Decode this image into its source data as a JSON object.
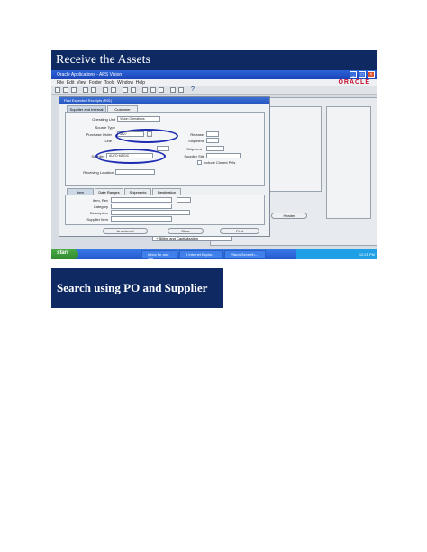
{
  "slide": {
    "title": "Receive the Assets",
    "caption": "Search using PO and Supplier"
  },
  "app": {
    "window_title": "Oracle Applications - ARS Vision",
    "menu": [
      "File",
      "Edit",
      "View",
      "Folder",
      "Tools",
      "Window",
      "Help"
    ],
    "brand": "ORACLE",
    "help_icon": "?"
  },
  "find_form": {
    "title": "Find Expected Receipts (R01)",
    "tabs": [
      "Supplier and Internal",
      "Customer"
    ],
    "fields": {
      "operating_unit_label": "Operating Unit",
      "operating_unit_value": "Vision Operations",
      "source_type_label": "Source Type",
      "purchase_order_label": "Purchase Order",
      "purchase_order_value": "5827",
      "line_label": "Line",
      "release_label": "Release",
      "shipment_label": "Shipment",
      "supplier_label": "Supplier",
      "supplier_value": "AUTO MAGIC",
      "supplier_site_label": "Supplier Site",
      "include_closed_label": "Include Closed POs",
      "receiving_location_label": "Receiving Location"
    },
    "lower_tabs": [
      "Item",
      "Date Ranges",
      "Shipments",
      "Destination"
    ],
    "lower_fields": {
      "item_rev_label": "Item, Rev",
      "category_label": "Category",
      "description_label": "Description",
      "supplier_item_label": "Supplier Item"
    },
    "buttons": {
      "unordered": "Unordered",
      "clear": "Clear",
      "find": "Find"
    }
  },
  "background": {
    "header_label": "Header",
    "billing_text": "+ Billing and Capitalization"
  },
  "taskbar": {
    "start": "start",
    "tasks": [
      "Inbox for and Am...",
      "4 Internet Explor...",
      "Vision Seventh..."
    ],
    "tray_time": "12:21 PM"
  }
}
